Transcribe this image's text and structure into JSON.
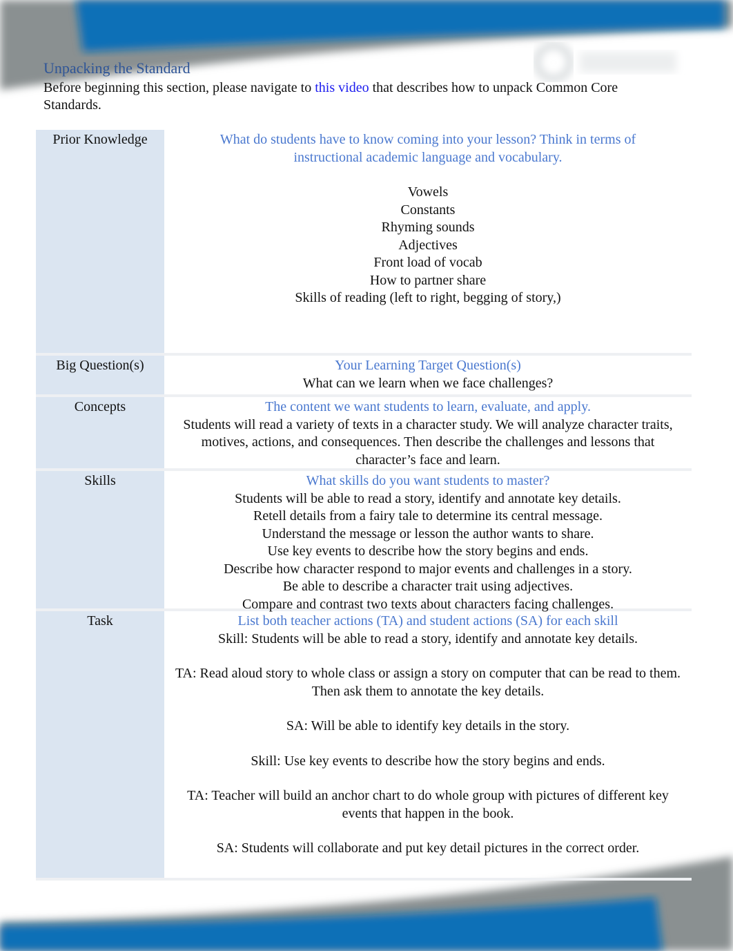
{
  "colors": {
    "heading": "#2f5597",
    "prompt": "#4a78cf",
    "link": "#1a1aee",
    "label_column": "#dbe5f1",
    "banner": "#0a6fb7"
  },
  "header": {
    "title": "Unpacking the Standard",
    "intro_before": "Before beginning this section, please navigate to ",
    "link_text": "this video",
    "intro_after": " that describes how to unpack Common Core Standards."
  },
  "rows": [
    {
      "label": "Prior Knowledge",
      "prompt": "What do students have to know coming into your lesson? Think in terms of instructional academic language and vocabulary.",
      "lines": [
        "Vowels",
        "Constants",
        "Rhyming sounds",
        "Adjectives",
        "Front load of vocab",
        "How to partner share",
        "Skills of reading (left to right, begging of story,)"
      ]
    },
    {
      "label": "Big Question(s)",
      "prompt": "Your Learning Target Question(s)",
      "lines": [
        "What can we learn when we face challenges?"
      ]
    },
    {
      "label": "Concepts",
      "prompt": "The content we want students to learn, evaluate, and apply.",
      "lines": [
        "Students will read a variety of texts in a character study. We will analyze character traits, motives, actions, and consequences. Then describe the challenges and lessons that character’s face and learn."
      ]
    },
    {
      "label": "Skills",
      "prompt": "What skills do you want students to master?",
      "lines": [
        "Students will be able to read a story, identify and annotate key details.",
        "Retell details from a fairy tale to determine its central message.",
        "Understand the message or lesson the author wants to share.",
        "Use key events to describe how the story begins and ends.",
        "Describe how character respond to major events and challenges in a story.",
        "Be able to describe a character trait using adjectives.",
        "Compare and contrast two texts about characters facing challenges."
      ]
    },
    {
      "label": "Task",
      "prompt": "List both teacher actions (TA) and student actions (SA) for each skill",
      "lines": [
        "Skill: Students will be able to read a story, identify and annotate key details.",
        "TA: Read aloud story to whole class or assign a story on computer that can be read to them. Then ask them to annotate the key details.",
        "SA: Will be able to identify key details in the story.",
        "Skill: Use key events to describe how the story begins and ends.",
        "TA: Teacher will build an anchor chart to do whole group with pictures of different key events that happen in the book.",
        "SA: Students will collaborate and put key detail pictures in the correct order."
      ]
    }
  ]
}
